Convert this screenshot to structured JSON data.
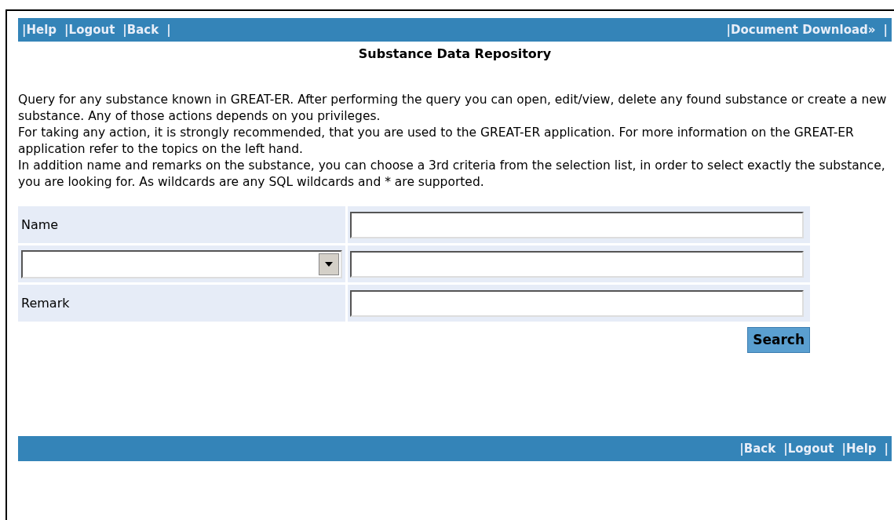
{
  "top_bar": {
    "links": [
      {
        "label": "|Help"
      },
      {
        "label": "|Logout"
      },
      {
        "label": "|Back"
      }
    ],
    "end": "|",
    "right_link": "|Document Download»",
    "right_end": "|"
  },
  "title": "Substance Data Repository",
  "paragraphs": [
    "Query for any substance known in GREAT-ER. After performing the query you can open, edit/view, delete any found substance or create a new substance. Any of those actions depends on you privileges.",
    "For taking any action, it is strongly recommended, that you are used to the GREAT-ER application. For more information on the GREAT-ER application refer to the topics on the left hand.",
    "In addition name and remarks on the substance, you can choose a 3rd criteria from the selection list, in order to select exactly the substance, you are looking for. As wildcards are any SQL wildcards and * are supported."
  ],
  "form": {
    "rows": [
      {
        "kind": "label",
        "label": "Name"
      },
      {
        "kind": "select"
      },
      {
        "kind": "label",
        "label": "Remark"
      }
    ],
    "search_button": "Search"
  },
  "bottom_bar": {
    "links": [
      {
        "label": "|Back"
      },
      {
        "label": "|Logout"
      },
      {
        "label": "|Help"
      }
    ],
    "end": "|"
  }
}
